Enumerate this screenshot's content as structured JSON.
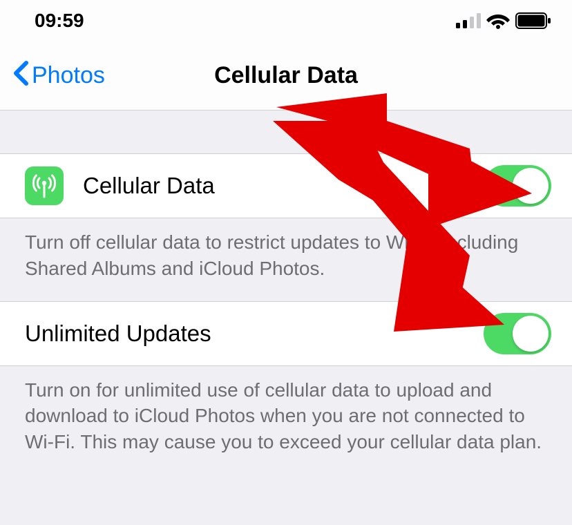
{
  "status_bar": {
    "time": "09:59"
  },
  "nav": {
    "back_label": "Photos",
    "title": "Cellular Data"
  },
  "rows": {
    "cellular_data": {
      "label": "Cellular Data",
      "footer": "Turn off cellular data to restrict updates to Wi-Fi, including Shared Albums and iCloud Photos.",
      "toggle_on": true
    },
    "unlimited_updates": {
      "label": "Unlimited Updates",
      "footer": "Turn on for unlimited use of cellular data to upload and download to iCloud Photos when you are not connected to Wi-Fi. This may cause you to exceed your cellular data plan.",
      "toggle_on": true
    }
  },
  "colors": {
    "accent": "#007aff",
    "toggle_on": "#4cd964",
    "row_icon_bg": "#4cd964",
    "footer_text": "#6d6d72",
    "bg": "#efeff4",
    "annotation": "#e50000"
  }
}
